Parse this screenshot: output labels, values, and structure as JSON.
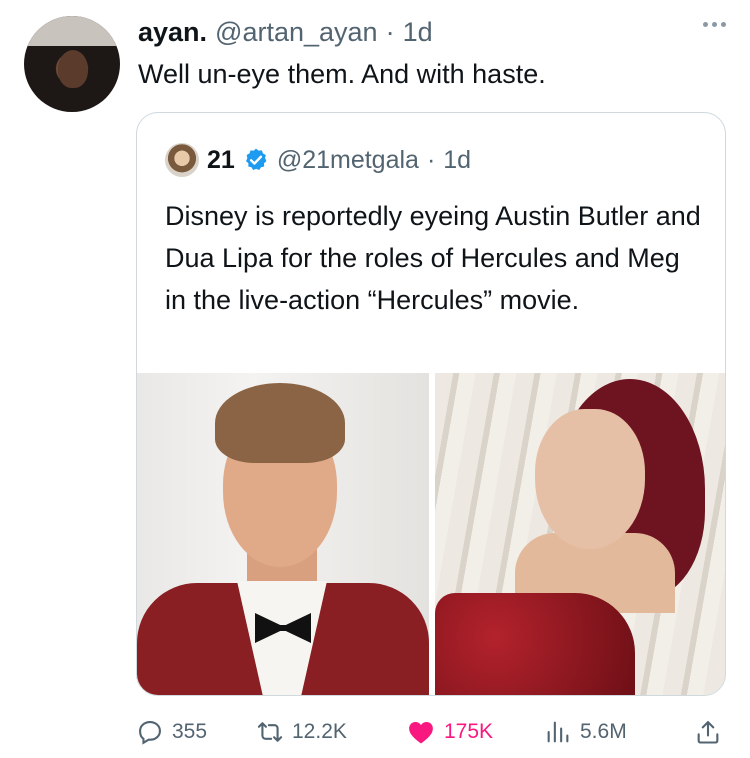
{
  "tweet": {
    "author_name": "ayan.",
    "author_handle": "@artan_ayan",
    "separator": "·",
    "time": "1d",
    "text": "Well un-eye them. And with haste."
  },
  "quoted_tweet": {
    "author_name": "21",
    "author_handle": "@21metgala",
    "separator": "·",
    "time": "1d",
    "text": "Disney is reportedly eyeing Austin Butler and Dua Lipa for the roles of Hercules and Meg in the live-action “Hercules” movie."
  },
  "actions": {
    "replies": "355",
    "retweets": "12.2K",
    "likes": "175K",
    "views": "5.6M"
  },
  "colors": {
    "text_primary": "#0f1419",
    "text_secondary": "#536471",
    "like": "#f91880",
    "verified": "#1d9bf0",
    "border": "#cfd9de"
  }
}
